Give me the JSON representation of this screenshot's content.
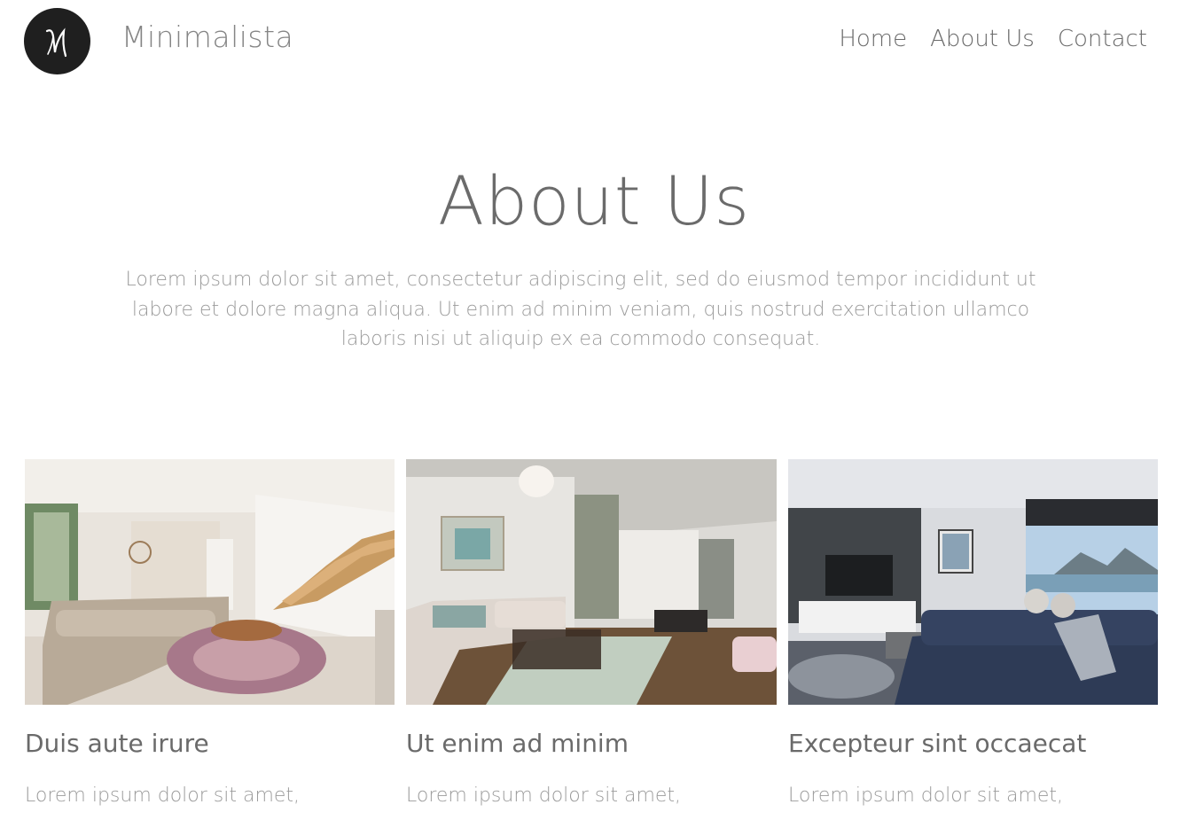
{
  "header": {
    "logo_letter": "M",
    "brand": "Minimalista",
    "nav": [
      {
        "label": "Home"
      },
      {
        "label": "About Us"
      },
      {
        "label": "Contact"
      }
    ]
  },
  "hero": {
    "title": "About Us",
    "text": "Lorem ipsum dolor sit amet, consectetur adipiscing elit, sed do eiusmod tempor incididunt ut labore et dolore magna aliqua. Ut enim ad minim veniam, quis nostrud exercitation ullamco laboris nisi ut aliquip ex ea commodo consequat."
  },
  "cards": [
    {
      "title": "Duis aute irure",
      "text": "Lorem ipsum dolor sit amet,",
      "image": "living-room-staircase-photo"
    },
    {
      "title": "Ut enim ad minim",
      "text": "Lorem ipsum dolor sit amet,",
      "image": "living-room-kitchen-photo"
    },
    {
      "title": "Excepteur sint occaecat",
      "text": "Lorem ipsum dolor sit amet,",
      "image": "living-room-sea-view-photo"
    }
  ],
  "colors": {
    "logo_bg": "#1f1f1f",
    "text_dark": "#6b6b6b",
    "text_light": "#9b9b9b"
  }
}
